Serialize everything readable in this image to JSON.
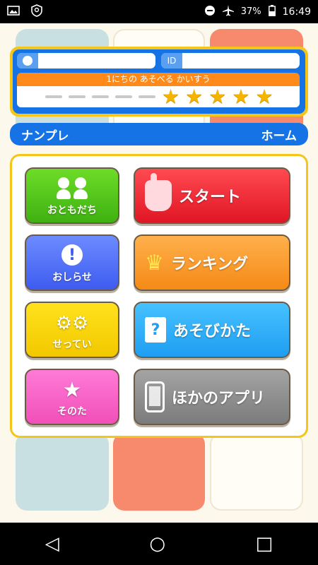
{
  "status_bar": {
    "battery": "37%",
    "time": "16:49",
    "icons": [
      "image-icon",
      "shield-icon",
      "do-not-disturb-icon",
      "airplane-icon",
      "battery-icon"
    ]
  },
  "profile": {
    "name_value": "",
    "id_tag": "ID",
    "id_value": "",
    "plays_label": "1にちの あそべる かいすう",
    "plays_remaining": 5,
    "plays_max": 10
  },
  "title_bar": {
    "app_name": "ナンプレ",
    "screen_name": "ホーム"
  },
  "menu": {
    "friends_label": "おともだち",
    "notice_label": "おしらせ",
    "settings_label": "せってい",
    "others_label": "そのた",
    "start_label": "スタート",
    "ranking_label": "ランキング",
    "howto_label": "あそびかた",
    "other_apps_label": "ほかのアプリ"
  },
  "colors": {
    "brand_blue": "#1673e6",
    "accent_yellow": "#f5c518",
    "orange": "#ff8a19"
  },
  "nav": {
    "back": "◁",
    "home": "○",
    "recents": "□"
  }
}
